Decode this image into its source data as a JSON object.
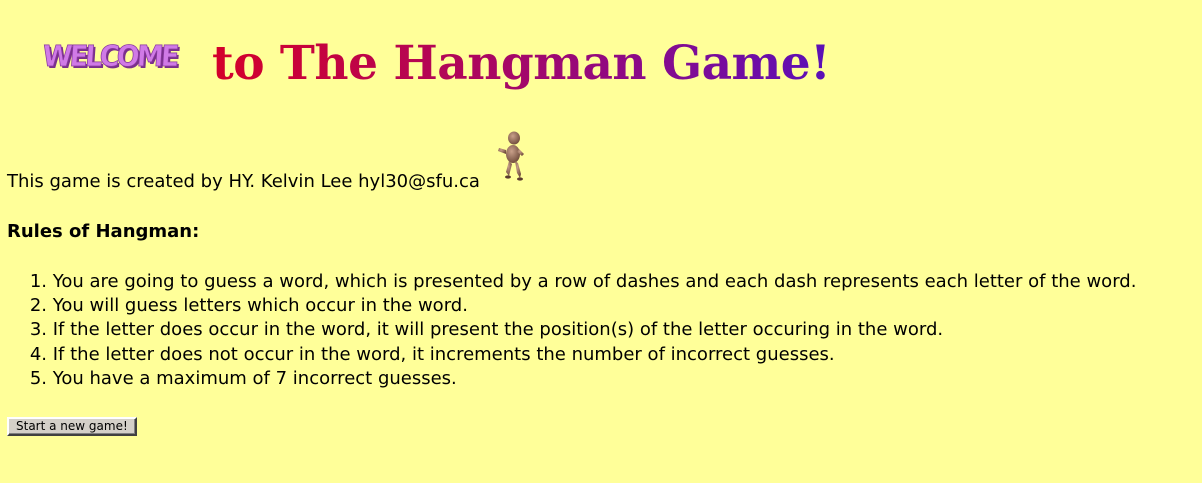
{
  "header": {
    "logo_text": "WELCOME",
    "title": "to The Hangman Game!"
  },
  "credit": "This game is created by HY. Kelvin Lee hyl30@sfu.ca",
  "rules": {
    "heading": "Rules of Hangman:",
    "items": [
      {
        "num": "1.",
        "text": "You are going to guess a word, which is presented by a row of dashes and each dash represents each letter of the word."
      },
      {
        "num": "2.",
        "text": "You will guess letters which occur in the word."
      },
      {
        "num": "3.",
        "text": "If the letter does occur in the word, it will present the position(s) of the letter occuring in the word."
      },
      {
        "num": "4.",
        "text": "If the letter does not occur in the word, it increments the number of incorrect guesses."
      },
      {
        "num": "5.",
        "text": "You have a maximum of 7 incorrect guesses."
      }
    ]
  },
  "start_button": {
    "label": "Start a new game!"
  },
  "colors": {
    "background": "#ffff99",
    "title_start": "#d4002a",
    "title_end": "#5a10b8",
    "logo": "#c060d8"
  }
}
